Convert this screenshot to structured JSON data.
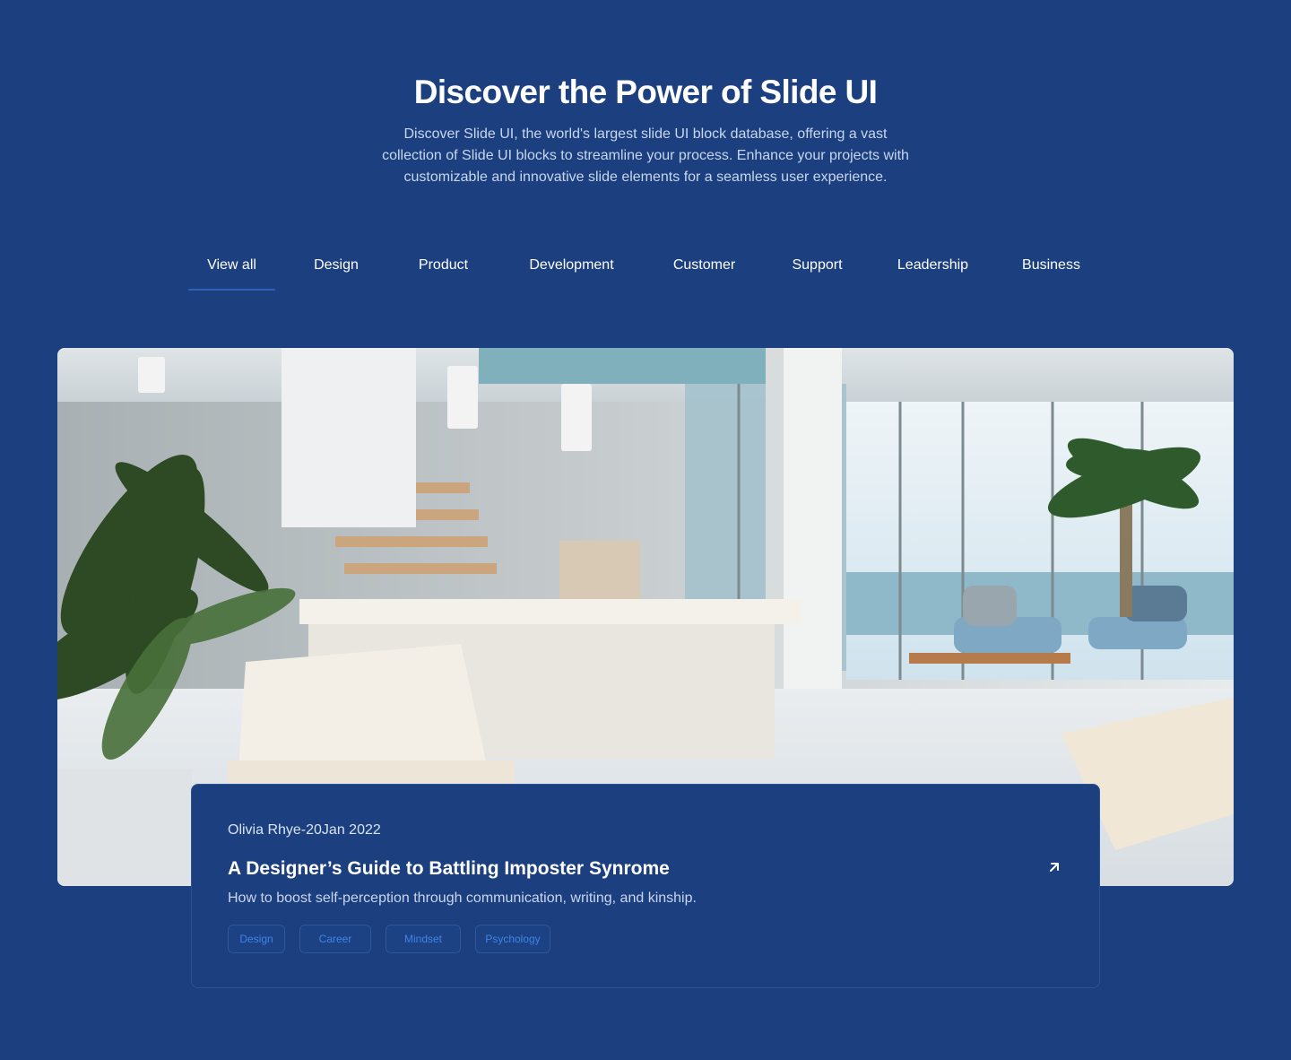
{
  "hero": {
    "title": "Discover the Power of Slide UI",
    "description_lines": [
      "Discover Slide UI, the world's largest slide UI block database, offering a vast",
      "collection of Slide UI blocks to streamline your process. Enhance your projects with",
      "customizable and innovative slide elements for a seamless user experience."
    ]
  },
  "tabs": [
    {
      "label": "View all",
      "active": true
    },
    {
      "label": "Design",
      "active": false
    },
    {
      "label": "Product",
      "active": false
    },
    {
      "label": "Development",
      "active": false
    },
    {
      "label": "Customer",
      "active": false
    },
    {
      "label": "Support",
      "active": false
    },
    {
      "label": "Leadership",
      "active": false
    },
    {
      "label": "Business",
      "active": false
    }
  ],
  "post": {
    "meta": "Olivia Rhye-20Jan 2022",
    "title": "A Designer’s Guide to Battling Imposter Synrome",
    "description": "How to boost self-perception through communication, writing, and kinship.",
    "tags": [
      "Design",
      "Career",
      "Mindset",
      "Psychology"
    ],
    "link_icon": "arrow-up-right-icon",
    "image": "modern-office-interior-photo"
  },
  "colors": {
    "background": "#1b3f7f",
    "tab_underline": "#2f61b8",
    "tag_text": "#3f83e6",
    "card_border": "#2a5398"
  }
}
